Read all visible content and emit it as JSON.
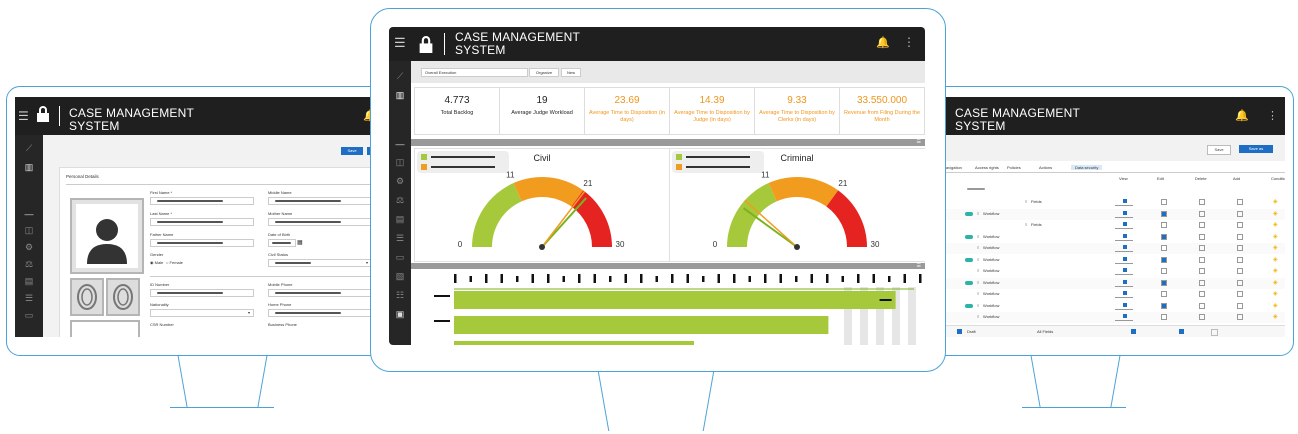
{
  "app": {
    "title_line1": "CASE MANAGEMENT",
    "title_line2": "SYSTEM"
  },
  "colors": {
    "accent": "#4aa3d6",
    "green": "#a5c93b",
    "orange": "#f29c1f",
    "red": "#e52421",
    "dark": "#1f1f1f",
    "blue": "#1e6fc4"
  },
  "icons": [
    "menu-icon",
    "lock-icon",
    "bell-icon",
    "more-icon"
  ],
  "left": {
    "save": "Save",
    "section": "Personal Details",
    "fields": [
      {
        "label": "First Name *"
      },
      {
        "label": "Middle Name"
      },
      {
        "label": "Last Name *"
      },
      {
        "label": "Mother Name"
      },
      {
        "label": "Father Name"
      },
      {
        "label": "Date of Birth"
      },
      {
        "label": "Gender"
      },
      {
        "label": "Civil Status"
      },
      {
        "label": "ID Number"
      },
      {
        "label": "Mobile Phone"
      },
      {
        "label": "Nationality"
      },
      {
        "label": "Home Phone"
      },
      {
        "label": "CSR Number"
      },
      {
        "label": "Business Phone"
      }
    ],
    "gender_male": "Male",
    "gender_female": "Female"
  },
  "center": {
    "filter": "Overall Execution",
    "organize": "Organize",
    "new": "New",
    "kpis": [
      {
        "value": "4.773",
        "label": "Total Backlog",
        "highlight": false
      },
      {
        "value": "19",
        "label": "Average Judge Workload",
        "highlight": false
      },
      {
        "value": "23.69",
        "label": "Average Time to Disposition (in days)",
        "highlight": true
      },
      {
        "value": "14.39",
        "label": "Average Time to Disposition by Judge (in days)",
        "highlight": true
      },
      {
        "value": "9.33",
        "label": "Average Time to Disposition by Clerks (in days)",
        "highlight": true
      },
      {
        "value": "33.550.000",
        "label": "Revenue from Filing During the Month",
        "highlight": true
      }
    ],
    "gauges": [
      {
        "title": "Civil",
        "min": "0",
        "t1": "11",
        "t2": "21",
        "max": "30",
        "value": 22
      },
      {
        "title": "Criminal",
        "min": "0",
        "t1": "11",
        "t2": "21",
        "max": "30",
        "value": 6
      }
    ],
    "bars": [
      0.92,
      0.78,
      0.5
    ]
  },
  "right": {
    "save": "Save",
    "save_as": "Save as",
    "tabs": [
      "Navigation",
      "Access rights",
      "Policies",
      "Actions",
      "Data security"
    ],
    "cols": [
      "View",
      "Edit",
      "Delete",
      "Add",
      "Conditions"
    ],
    "rows": [
      "Fields",
      "Workflow",
      "Fields",
      "Workflow",
      "Workflow",
      "Workflow",
      "Workflow",
      "Workflow",
      "Workflow",
      "Workflow",
      "Workflow"
    ],
    "footer_draft": "Draft",
    "footer_all": "All Fields"
  }
}
